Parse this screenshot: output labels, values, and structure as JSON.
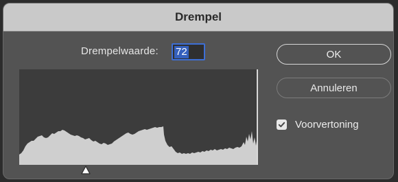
{
  "dialog": {
    "title": "Drempel"
  },
  "threshold": {
    "label": "Drempelwaarde:",
    "value": "72"
  },
  "buttons": {
    "ok": "OK",
    "cancel": "Annuleren"
  },
  "preview": {
    "label": "Voorvertoning",
    "checked": true
  },
  "colors": {
    "dialog_bg": "#535353",
    "titlebar_bg": "#c9c9c9",
    "histogram_fill": "#cfcfcf",
    "selection": "#3560bd"
  },
  "icons": {
    "slider_handle": "triangle-handle-icon",
    "checkbox": "checkmark-icon"
  }
}
